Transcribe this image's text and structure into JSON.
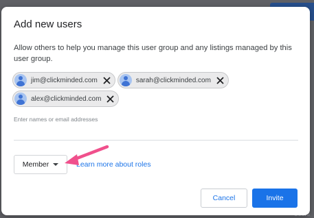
{
  "dialog": {
    "title": "Add new users",
    "description": "Allow others to help you manage this user group and any listings managed by this user group.",
    "chips": [
      {
        "email": "jim@clickminded.com"
      },
      {
        "email": "sarah@clickminded.com"
      },
      {
        "email": "alex@clickminded.com"
      }
    ],
    "input_placeholder": "Enter names or email addresses",
    "role_select": {
      "selected": "Member"
    },
    "learn_more_link": "Learn more about roles",
    "cancel_label": "Cancel",
    "invite_label": "Invite"
  },
  "colors": {
    "accent": "#1a73e8",
    "annotation_arrow": "#f0508c",
    "backdrop": "#5f6065"
  },
  "icons": {
    "chip_avatar": "person-avatar-icon",
    "chip_remove": "close-icon",
    "role_dropdown": "caret-down-icon"
  }
}
